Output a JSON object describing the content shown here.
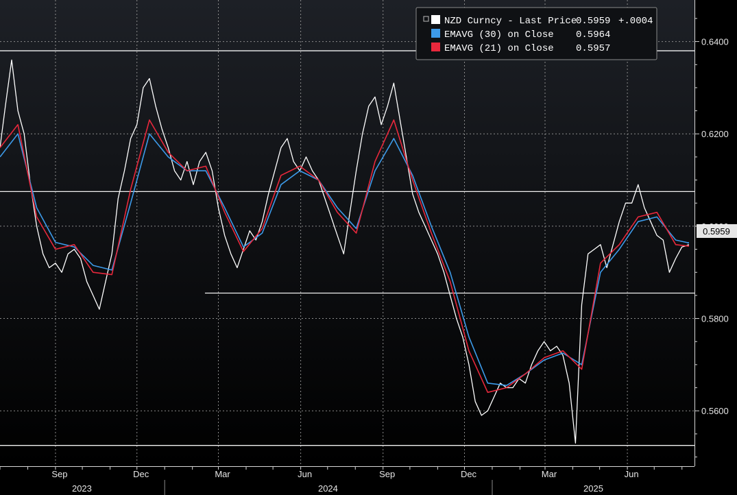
{
  "chart_data": {
    "type": "line",
    "ticker": "NZD Curncy",
    "legend": [
      {
        "label": "NZD Curncy - Last Price",
        "value": "0.5959",
        "change": "+.0004",
        "color": "#ffffff"
      },
      {
        "label": "EMAVG (30)  on Close",
        "value": "0.5964",
        "color": "#3d9bea"
      },
      {
        "label": "EMAVG (21)  on Close",
        "value": "0.5957",
        "color": "#e8283c"
      }
    ],
    "last_price_label": "0.5959",
    "ylim": [
      0.548,
      0.649
    ],
    "yticks": [
      {
        "value": 0.64,
        "label": "0.6400"
      },
      {
        "value": 0.62,
        "label": "0.6200"
      },
      {
        "value": 0.6,
        "label": "0.6000"
      },
      {
        "value": 0.58,
        "label": "0.5800"
      },
      {
        "value": 0.56,
        "label": "0.5600"
      }
    ],
    "xlim": [
      "2023-07-01",
      "2025-08-15"
    ],
    "month_ticks": [
      {
        "label": "Sep",
        "date": "2023-09-01"
      },
      {
        "label": "Dec",
        "date": "2023-12-01"
      },
      {
        "label": "Mar",
        "date": "2024-03-01"
      },
      {
        "label": "Jun",
        "date": "2024-06-01"
      },
      {
        "label": "Sep",
        "date": "2024-09-01"
      },
      {
        "label": "Dec",
        "date": "2024-12-01"
      },
      {
        "label": "Mar",
        "date": "2025-03-01"
      },
      {
        "label": "Jun",
        "date": "2025-06-01"
      }
    ],
    "years": [
      {
        "label": "2023",
        "start": "2023-07-01",
        "end": "2023-12-31"
      },
      {
        "label": "2024",
        "start": "2024-01-01",
        "end": "2024-12-31"
      },
      {
        "label": "2025",
        "start": "2025-01-01",
        "end": "2025-08-15"
      }
    ],
    "horizontal_levels": [
      {
        "value": 0.638,
        "from": "2023-07-01"
      },
      {
        "value": 0.6075,
        "from": "2023-07-01"
      },
      {
        "value": 0.5855,
        "from": "2024-02-15"
      },
      {
        "value": 0.5525,
        "from": "2023-07-01"
      }
    ],
    "grid": true,
    "series": [
      {
        "name": "NZD Curncy - Last Price",
        "color": "#ffffff",
        "x": [
          "2023-07-01",
          "2023-07-07",
          "2023-07-14",
          "2023-07-21",
          "2023-07-28",
          "2023-08-04",
          "2023-08-11",
          "2023-08-18",
          "2023-08-25",
          "2023-09-01",
          "2023-09-08",
          "2023-09-15",
          "2023-09-22",
          "2023-09-29",
          "2023-10-06",
          "2023-10-13",
          "2023-10-20",
          "2023-10-27",
          "2023-11-03",
          "2023-11-10",
          "2023-11-17",
          "2023-11-24",
          "2023-12-01",
          "2023-12-08",
          "2023-12-15",
          "2023-12-22",
          "2023-12-29",
          "2024-01-05",
          "2024-01-12",
          "2024-01-19",
          "2024-01-26",
          "2024-02-02",
          "2024-02-09",
          "2024-02-16",
          "2024-02-23",
          "2024-03-01",
          "2024-03-08",
          "2024-03-15",
          "2024-03-22",
          "2024-03-29",
          "2024-04-05",
          "2024-04-12",
          "2024-04-19",
          "2024-04-26",
          "2024-05-03",
          "2024-05-10",
          "2024-05-17",
          "2024-05-24",
          "2024-05-31",
          "2024-06-07",
          "2024-06-14",
          "2024-06-21",
          "2024-06-28",
          "2024-07-05",
          "2024-07-12",
          "2024-07-19",
          "2024-07-26",
          "2024-08-02",
          "2024-08-09",
          "2024-08-16",
          "2024-08-23",
          "2024-08-30",
          "2024-09-06",
          "2024-09-13",
          "2024-09-20",
          "2024-09-27",
          "2024-10-04",
          "2024-10-11",
          "2024-10-18",
          "2024-10-25",
          "2024-11-01",
          "2024-11-08",
          "2024-11-15",
          "2024-11-22",
          "2024-11-29",
          "2024-12-06",
          "2024-12-13",
          "2024-12-20",
          "2024-12-27",
          "2025-01-03",
          "2025-01-10",
          "2025-01-17",
          "2025-01-24",
          "2025-01-31",
          "2025-02-07",
          "2025-02-14",
          "2025-02-21",
          "2025-02-28",
          "2025-03-07",
          "2025-03-14",
          "2025-03-21",
          "2025-03-28",
          "2025-04-04",
          "2025-04-11",
          "2025-04-18",
          "2025-04-25",
          "2025-05-02",
          "2025-05-09",
          "2025-05-16",
          "2025-05-23",
          "2025-05-30",
          "2025-06-06",
          "2025-06-13",
          "2025-06-20",
          "2025-06-27",
          "2025-07-04",
          "2025-07-11",
          "2025-07-18",
          "2025-07-25",
          "2025-08-01",
          "2025-08-08"
        ],
        "values": [
          0.617,
          0.626,
          0.636,
          0.625,
          0.62,
          0.609,
          0.6,
          0.594,
          0.591,
          0.592,
          0.59,
          0.594,
          0.595,
          0.593,
          0.588,
          0.585,
          0.582,
          0.588,
          0.594,
          0.606,
          0.612,
          0.619,
          0.622,
          0.63,
          0.632,
          0.626,
          0.621,
          0.617,
          0.612,
          0.61,
          0.614,
          0.609,
          0.614,
          0.616,
          0.612,
          0.604,
          0.598,
          0.594,
          0.591,
          0.595,
          0.599,
          0.597,
          0.601,
          0.607,
          0.612,
          0.617,
          0.619,
          0.614,
          0.612,
          0.615,
          0.612,
          0.61,
          0.606,
          0.602,
          0.598,
          0.594,
          0.603,
          0.612,
          0.62,
          0.626,
          0.628,
          0.622,
          0.626,
          0.631,
          0.623,
          0.615,
          0.607,
          0.603,
          0.6,
          0.597,
          0.594,
          0.59,
          0.585,
          0.58,
          0.576,
          0.57,
          0.562,
          0.559,
          0.56,
          0.563,
          0.566,
          0.565,
          0.565,
          0.567,
          0.566,
          0.57,
          0.573,
          0.575,
          0.573,
          0.574,
          0.572,
          0.566,
          0.553,
          0.583,
          0.594,
          0.595,
          0.596,
          0.591,
          0.596,
          0.601,
          0.605,
          0.605,
          0.609,
          0.604,
          0.601,
          0.598,
          0.597,
          0.59,
          0.593,
          0.5955,
          0.5959
        ]
      },
      {
        "name": "EMAVG (30)  on Close",
        "color": "#3d9bea",
        "x": [
          "2023-07-01",
          "2023-07-21",
          "2023-08-11",
          "2023-09-01",
          "2023-09-22",
          "2023-10-13",
          "2023-11-03",
          "2023-11-24",
          "2023-12-15",
          "2024-01-05",
          "2024-01-26",
          "2024-02-16",
          "2024-03-08",
          "2024-03-29",
          "2024-04-19",
          "2024-05-10",
          "2024-05-31",
          "2024-06-21",
          "2024-07-12",
          "2024-08-02",
          "2024-08-23",
          "2024-09-13",
          "2024-10-04",
          "2024-10-25",
          "2024-11-15",
          "2024-12-06",
          "2024-12-27",
          "2025-01-17",
          "2025-02-07",
          "2025-02-28",
          "2025-03-21",
          "2025-04-11",
          "2025-05-02",
          "2025-05-23",
          "2025-06-13",
          "2025-07-04",
          "2025-07-25",
          "2025-08-08"
        ],
        "values": [
          0.615,
          0.62,
          0.604,
          0.5965,
          0.5955,
          0.5915,
          0.5905,
          0.605,
          0.62,
          0.615,
          0.612,
          0.612,
          0.604,
          0.5955,
          0.5985,
          0.609,
          0.612,
          0.61,
          0.604,
          0.5995,
          0.612,
          0.619,
          0.611,
          0.6,
          0.59,
          0.576,
          0.566,
          0.5655,
          0.568,
          0.571,
          0.5725,
          0.57,
          0.59,
          0.595,
          0.601,
          0.602,
          0.597,
          0.5964
        ]
      },
      {
        "name": "EMAVG (21)  on Close",
        "color": "#e8283c",
        "x": [
          "2023-07-01",
          "2023-07-21",
          "2023-08-11",
          "2023-09-01",
          "2023-09-22",
          "2023-10-13",
          "2023-11-03",
          "2023-11-24",
          "2023-12-15",
          "2024-01-05",
          "2024-01-26",
          "2024-02-16",
          "2024-03-08",
          "2024-03-29",
          "2024-04-19",
          "2024-05-10",
          "2024-05-31",
          "2024-06-21",
          "2024-07-12",
          "2024-08-02",
          "2024-08-23",
          "2024-09-13",
          "2024-10-04",
          "2024-10-25",
          "2024-11-15",
          "2024-12-06",
          "2024-12-27",
          "2025-01-17",
          "2025-02-07",
          "2025-02-28",
          "2025-03-21",
          "2025-04-11",
          "2025-05-02",
          "2025-05-23",
          "2025-06-13",
          "2025-07-04",
          "2025-07-25",
          "2025-08-08"
        ],
        "values": [
          0.617,
          0.622,
          0.602,
          0.595,
          0.596,
          0.59,
          0.5895,
          0.608,
          0.623,
          0.616,
          0.612,
          0.613,
          0.603,
          0.5945,
          0.5995,
          0.611,
          0.613,
          0.61,
          0.603,
          0.5985,
          0.614,
          0.623,
          0.61,
          0.5985,
          0.588,
          0.573,
          0.564,
          0.565,
          0.568,
          0.5715,
          0.573,
          0.569,
          0.592,
          0.596,
          0.602,
          0.603,
          0.596,
          0.5957
        ]
      }
    ]
  }
}
